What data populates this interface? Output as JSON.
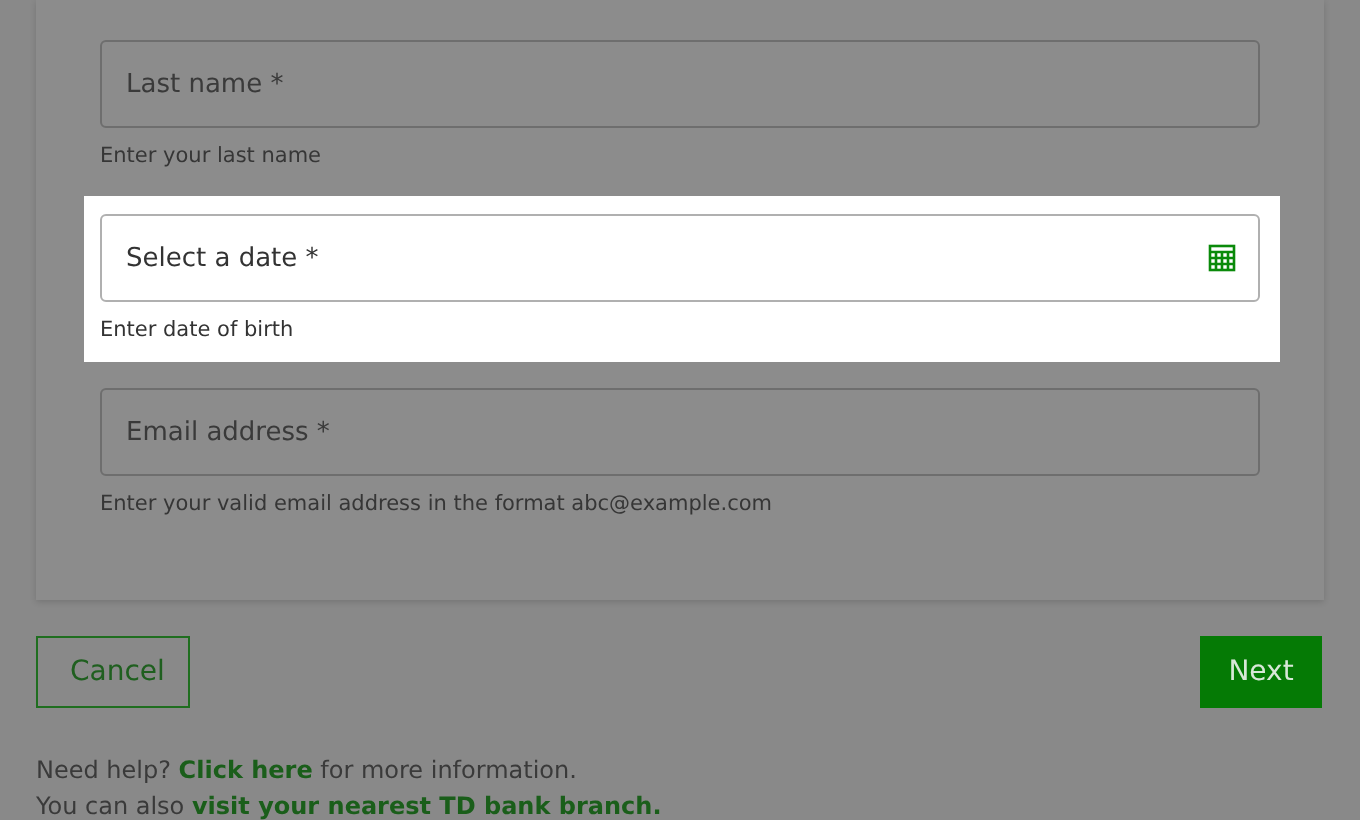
{
  "fields": [
    {
      "placeholder": "Last name *",
      "helper": "Enter your last name",
      "kind": "text",
      "highlighted": false
    },
    {
      "placeholder": "Select a date *",
      "helper": "Enter date of birth",
      "kind": "date",
      "highlighted": true
    },
    {
      "placeholder": "Email address *",
      "helper": "Enter your valid email address in the format abc@example.com",
      "kind": "text",
      "highlighted": false
    }
  ],
  "buttons": {
    "cancel": "Cancel",
    "next": "Next"
  },
  "help": [
    {
      "before": "Need help? ",
      "link": "Click here",
      "after": " for more information."
    },
    {
      "before": "You can also ",
      "link": "visit your nearest TD bank branch."
    }
  ]
}
